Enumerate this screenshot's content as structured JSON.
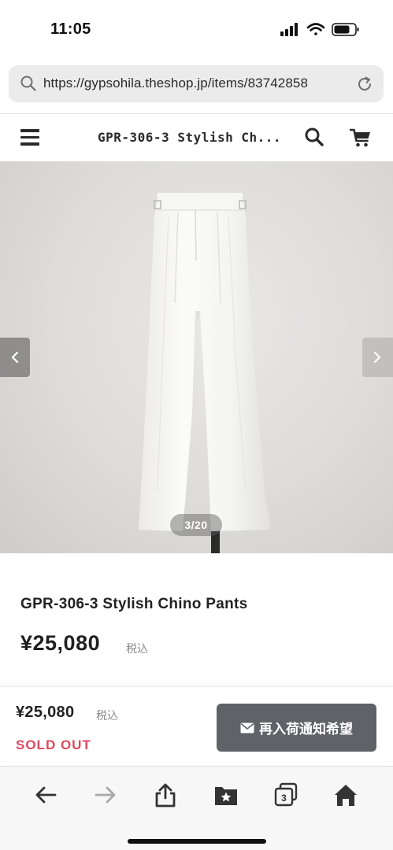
{
  "status_bar": {
    "time": "11:05",
    "icons": [
      "signal-icon",
      "wifi-icon",
      "battery-icon"
    ]
  },
  "url_bar": {
    "url": "https://gypsohila.theshop.jp/items/83742858",
    "icons": [
      "search-icon",
      "reload-icon"
    ]
  },
  "header": {
    "title": "GPR-306-3 Stylish Ch...",
    "icons": [
      "menu-icon",
      "search-icon",
      "cart-icon"
    ]
  },
  "carousel": {
    "counter": "3/20",
    "icons": [
      "chevron-left-icon",
      "chevron-right-icon"
    ]
  },
  "product": {
    "name": "GPR-306-3 Stylish Chino Pants",
    "price": "¥25,080",
    "tax_label": "税込"
  },
  "purchase_bar": {
    "price": "¥25,080",
    "tax_label": "税込",
    "status": "SOLD OUT",
    "notify_label": "再入荷通知希望",
    "notify_icon": "mail-icon"
  },
  "browser_toolbar": {
    "tabs_count": "3",
    "icons": [
      "back-arrow-icon",
      "forward-arrow-icon",
      "share-icon",
      "bookmarks-icon",
      "tabs-icon",
      "home-icon"
    ]
  },
  "colors": {
    "sold_out": "#e0485f",
    "notify_button": "#5f6368",
    "url_bar_bg": "#ebebec"
  }
}
